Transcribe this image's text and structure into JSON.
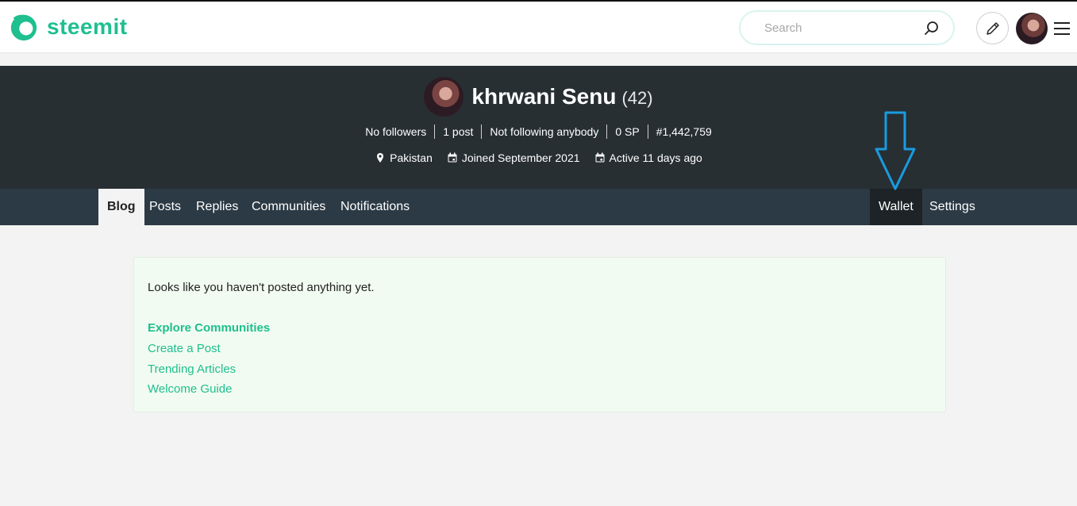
{
  "header": {
    "logo_text": "steemit",
    "search_placeholder": "Search"
  },
  "profile": {
    "name": "khrwani Senu",
    "reputation": "(42)",
    "stats": [
      "No followers",
      "1 post",
      "Not following anybody",
      "0 SP",
      "#1,442,759"
    ],
    "location": "Pakistan",
    "joined": "Joined September 2021",
    "active": "Active 11 days ago"
  },
  "nav": {
    "tabs": [
      "Blog",
      "Posts",
      "Replies",
      "Communities",
      "Notifications"
    ],
    "right_tabs": [
      "Wallet",
      "Settings"
    ],
    "active_tab": "Blog"
  },
  "content": {
    "empty_message": "Looks like you haven't posted anything yet.",
    "links": [
      "Explore Communities",
      "Create a Post",
      "Trending Articles",
      "Welcome Guide"
    ]
  },
  "colors": {
    "brand": "#1fbf8f",
    "banner": "#272f33",
    "nav": "#2c3a45",
    "annotation_arrow": "#1a9be0"
  },
  "icons": {
    "search": "search-icon",
    "pen": "pencil-icon",
    "menu": "hamburger-menu-icon",
    "location": "map-pin-icon",
    "calendar": "calendar-icon",
    "arrow": "down-arrow-annotation-icon"
  }
}
